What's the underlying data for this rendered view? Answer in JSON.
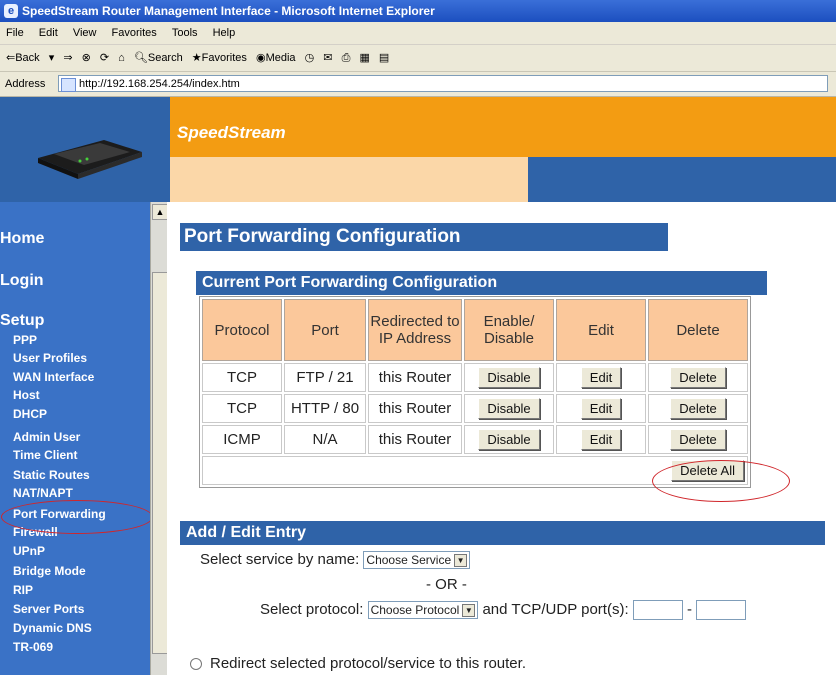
{
  "window": {
    "title": "SpeedStream Router Management Interface - Microsoft Internet Explorer"
  },
  "menu": [
    "File",
    "Edit",
    "View",
    "Favorites",
    "Tools",
    "Help"
  ],
  "toolbar": {
    "back": "⇐Back",
    "search": "Search",
    "favorites": "Favorites",
    "media": "Media"
  },
  "address": {
    "label": "Address",
    "url": "http://192.168.254.254/index.htm"
  },
  "brand": "SpeedStream",
  "sidebar": {
    "home": "Home",
    "login": "Login",
    "setup": "Setup",
    "items": [
      "PPP",
      "User Profiles",
      "WAN Interface",
      "Host",
      "DHCP",
      "Admin User",
      "Time Client",
      "Static Routes",
      "NAT/NAPT",
      "Port Forwarding",
      "Firewall",
      "UPnP",
      "Bridge Mode",
      "RIP",
      "Server Ports",
      "Dynamic DNS",
      "TR-069"
    ]
  },
  "main": {
    "title": "Port Forwarding Configuration",
    "current_title": "Current Port Forwarding Configuration",
    "headers": [
      "Protocol",
      "Port",
      "Redirected to IP Address",
      "Enable/ Disable",
      "Edit",
      "Delete"
    ],
    "rows": [
      {
        "protocol": "TCP",
        "port": "FTP / 21",
        "redirect": "this Router",
        "toggle": "Disable",
        "edit": "Edit",
        "delete": "Delete"
      },
      {
        "protocol": "TCP",
        "port": "HTTP / 80",
        "redirect": "this Router",
        "toggle": "Disable",
        "edit": "Edit",
        "delete": "Delete"
      },
      {
        "protocol": "ICMP",
        "port": "N/A",
        "redirect": "this Router",
        "toggle": "Disable",
        "edit": "Edit",
        "delete": "Delete"
      }
    ],
    "delete_all": "Delete All",
    "add_title": "Add / Edit Entry",
    "service_label": "Select service by name:",
    "service_value": "Choose Service",
    "or_text": "- OR -",
    "protocol_label": "Select protocol:",
    "protocol_value": "Choose Protocol",
    "ports_label": "and TCP/UDP port(s):",
    "ports_dash": "-",
    "radio_label": "Redirect selected protocol/service to this router."
  }
}
